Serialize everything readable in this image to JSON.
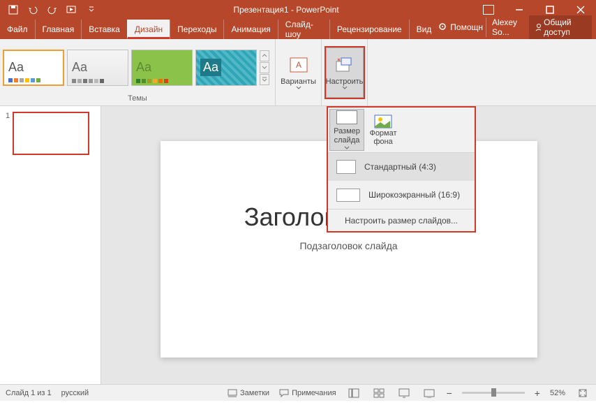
{
  "title": "Презентация1 - PowerPoint",
  "qat": {
    "save": "save",
    "undo": "undo",
    "redo": "redo",
    "start": "start"
  },
  "tabs": {
    "file": "Файл",
    "home": "Главная",
    "insert": "Вставка",
    "design": "Дизайн",
    "transitions": "Переходы",
    "animation": "Анимация",
    "slideshow": "Слайд-шоу",
    "review": "Рецензирование",
    "view": "Вид"
  },
  "right_tabs": {
    "help": "Помощн",
    "account": "Alexey So...",
    "share": "Общий доступ"
  },
  "ribbon": {
    "themes_label": "Темы",
    "variants": "Варианты",
    "customize": "Настроить"
  },
  "dropdown": {
    "slide_size": "Размер слайда",
    "format_bg": "Формат фона",
    "standard": "Стандартный (4:3)",
    "widescreen": "Широкоэкранный (16:9)",
    "custom": "Настроить размер слайдов..."
  },
  "thumbs": {
    "num1": "1"
  },
  "slide": {
    "title": "Заголовок слайда",
    "subtitle": "Подзаголовок слайда"
  },
  "status": {
    "slide_info": "Слайд 1 из 1",
    "lang": "русский",
    "notes": "Заметки",
    "comments": "Примечания",
    "zoom": "52%"
  }
}
